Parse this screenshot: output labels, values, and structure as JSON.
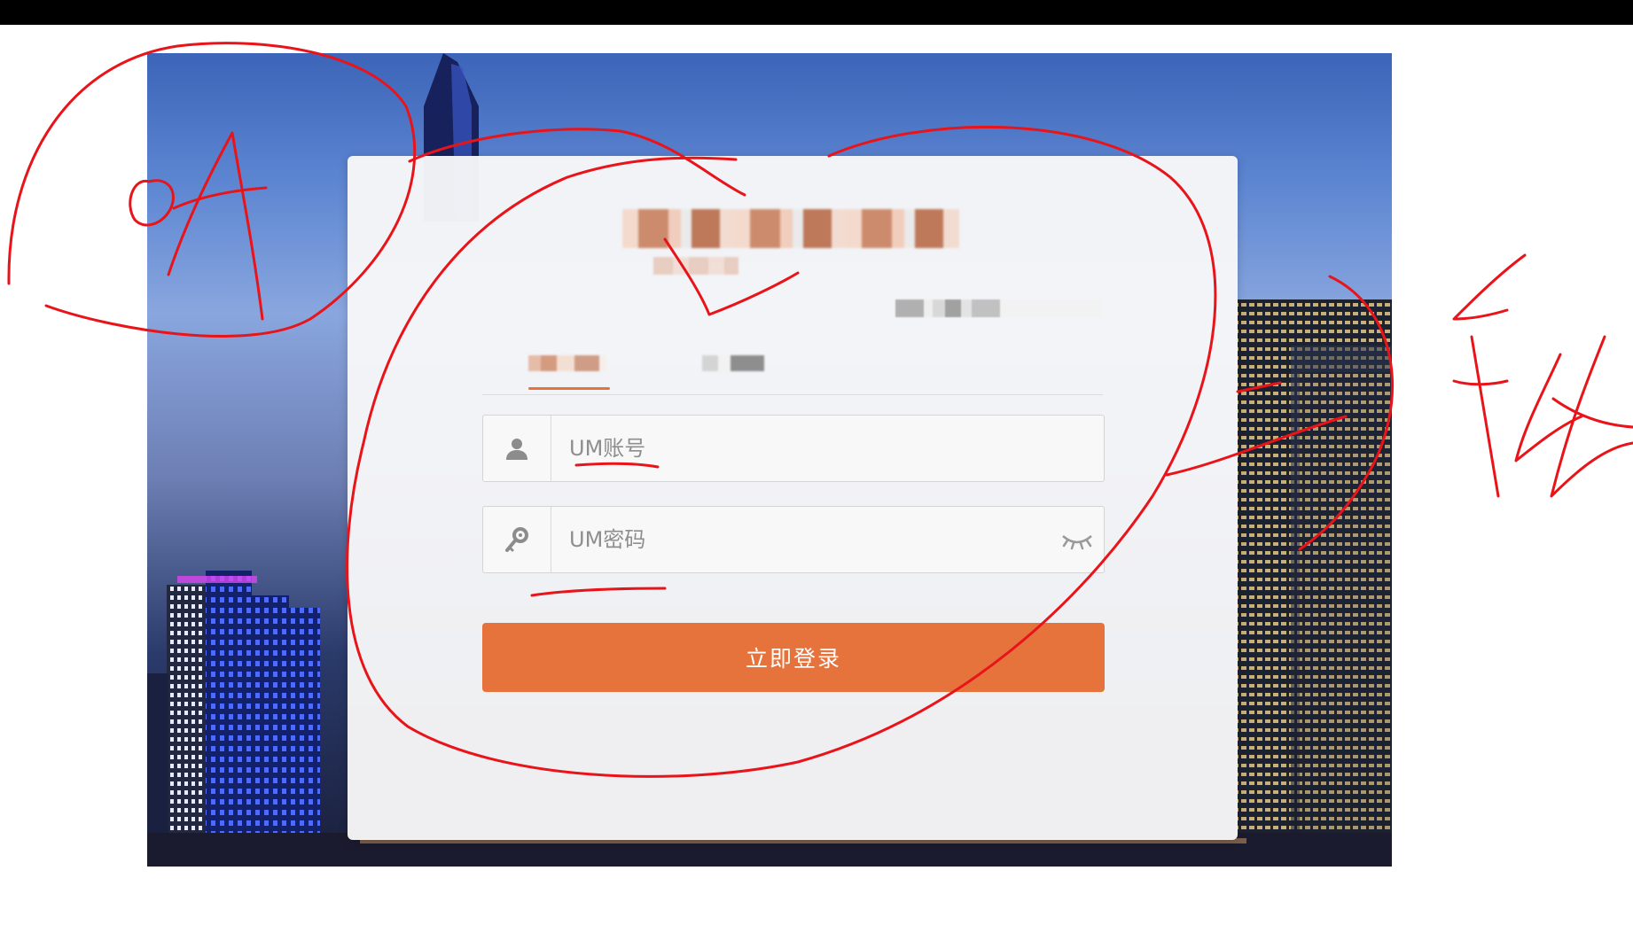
{
  "login_form": {
    "username_placeholder": "UM账号",
    "password_placeholder": "UM密码",
    "submit_label": "立即登录"
  },
  "colors": {
    "accent": "#e6733c",
    "annotation": "#e8141a",
    "top_bar": "#000000"
  },
  "icons": {
    "username_field": "user-icon",
    "password_field": "key-icon",
    "password_toggle": "eye-closed-icon"
  }
}
